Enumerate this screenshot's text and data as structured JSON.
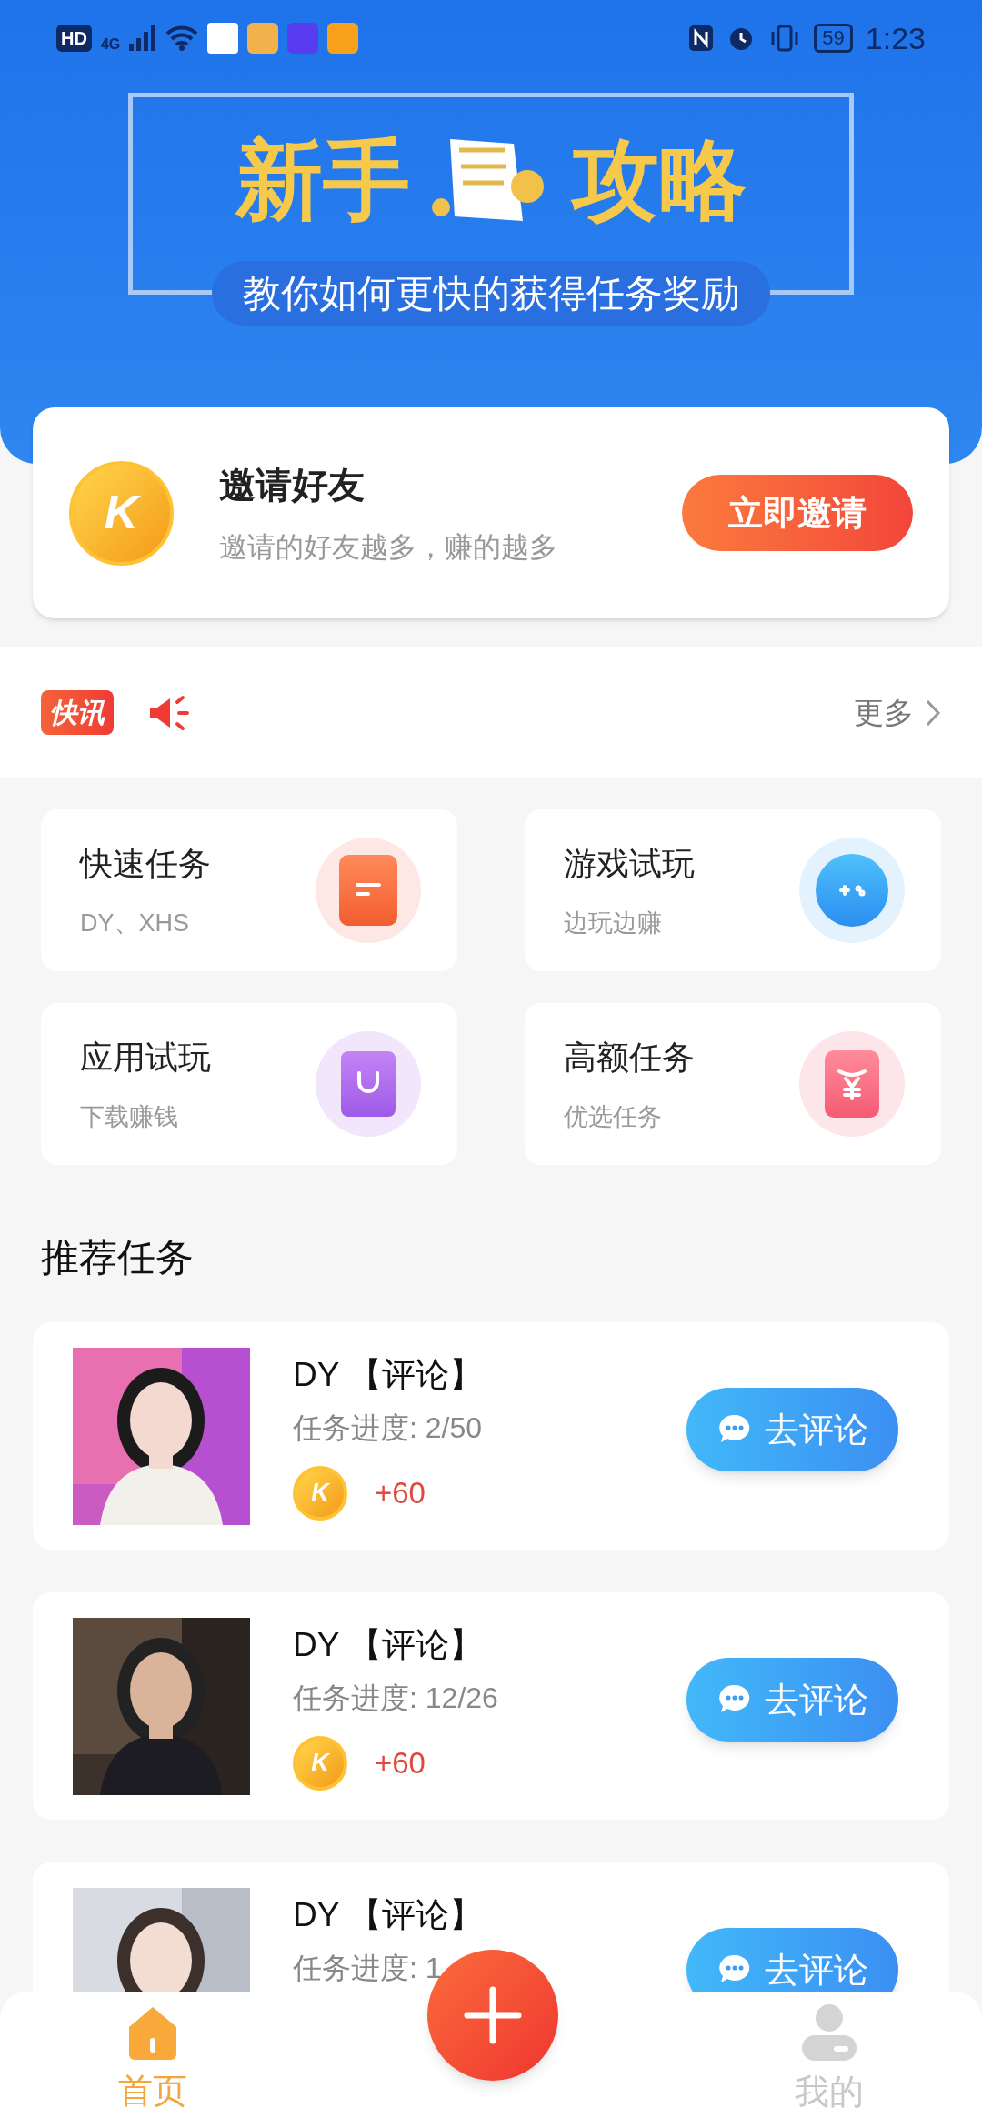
{
  "status_bar": {
    "hd": "HD",
    "network": "4G",
    "battery": "59",
    "time": "1:23"
  },
  "banner": {
    "title_left": "新手",
    "title_right": "攻略",
    "subtitle": "教你如何更快的获得任务奖励"
  },
  "invite": {
    "coin": "K",
    "title": "邀请好友",
    "subtitle": "邀请的好友越多，赚的越多",
    "button": "立即邀请"
  },
  "news": {
    "badge": "快讯",
    "more": "更多"
  },
  "categories": [
    {
      "title": "快速任务",
      "subtitle": "DY、XHS",
      "kind": "document"
    },
    {
      "title": "游戏试玩",
      "subtitle": "边玩边赚",
      "kind": "game"
    },
    {
      "title": "应用试玩",
      "subtitle": "下载赚钱",
      "kind": "bag"
    },
    {
      "title": "高额任务",
      "subtitle": "优选任务",
      "kind": "money"
    }
  ],
  "section_title": "推荐任务",
  "tasks": [
    {
      "title": "DY 【评论】",
      "progress": "任务进度: 2/50",
      "coin": "K",
      "reward": "+60",
      "button": "去评论"
    },
    {
      "title": "DY 【评论】",
      "progress": "任务进度: 12/26",
      "coin": "K",
      "reward": "+60",
      "button": "去评论"
    },
    {
      "title": "DY 【评论】",
      "progress": "任务进度: 1",
      "button": "去评论"
    }
  ],
  "nav": [
    {
      "label": "首页",
      "kind": "home",
      "selected": true
    },
    {
      "label": "我的",
      "kind": "profile",
      "selected": false
    }
  ]
}
